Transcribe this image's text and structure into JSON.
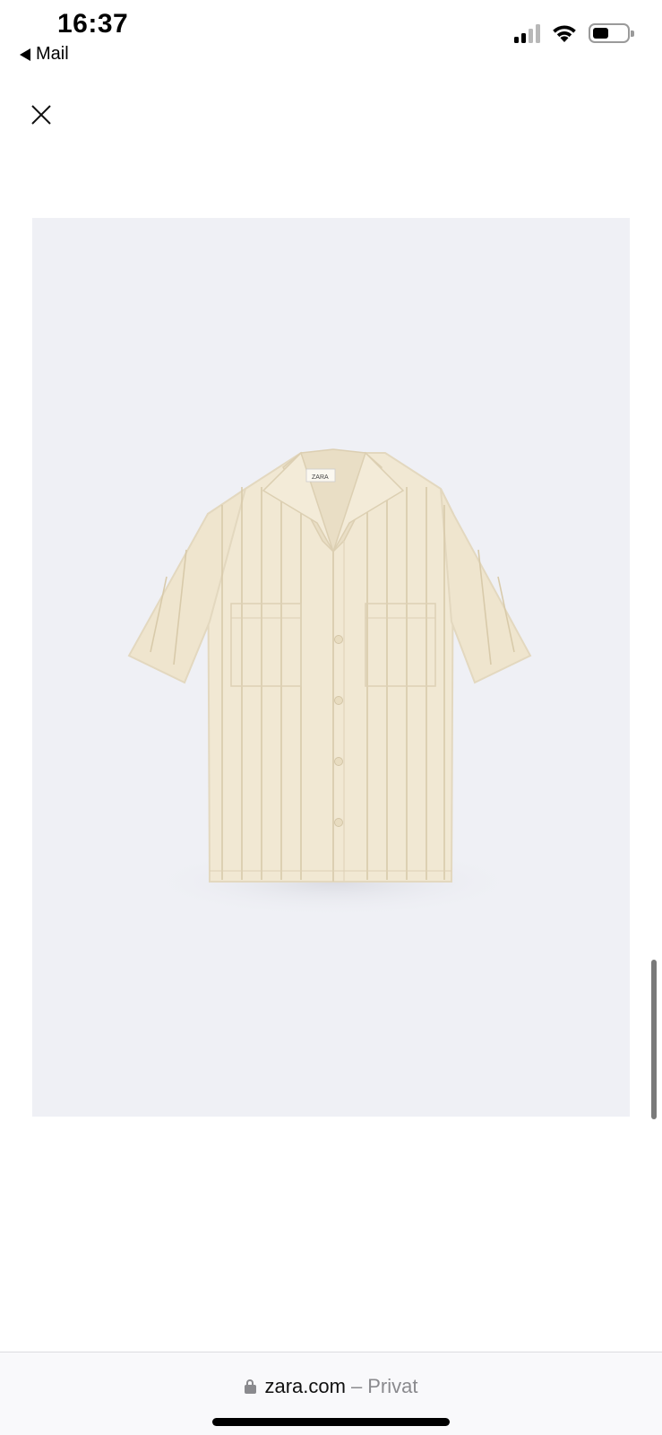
{
  "status_bar": {
    "time": "16:37",
    "back_app": "Mail",
    "icons": [
      "cellular-signal-icon",
      "wifi-icon",
      "battery-icon"
    ]
  },
  "toolbar": {
    "close_icon": "close-icon"
  },
  "product": {
    "image_subject": "shirt-image",
    "label_text": "ZARA"
  },
  "browser": {
    "domain": "zara.com",
    "separator": "–",
    "mode": "Privat"
  },
  "colors": {
    "image_background": "#eff0f5",
    "shirt": "#f1e8d3",
    "url_suffix": "#8a8a8e"
  }
}
